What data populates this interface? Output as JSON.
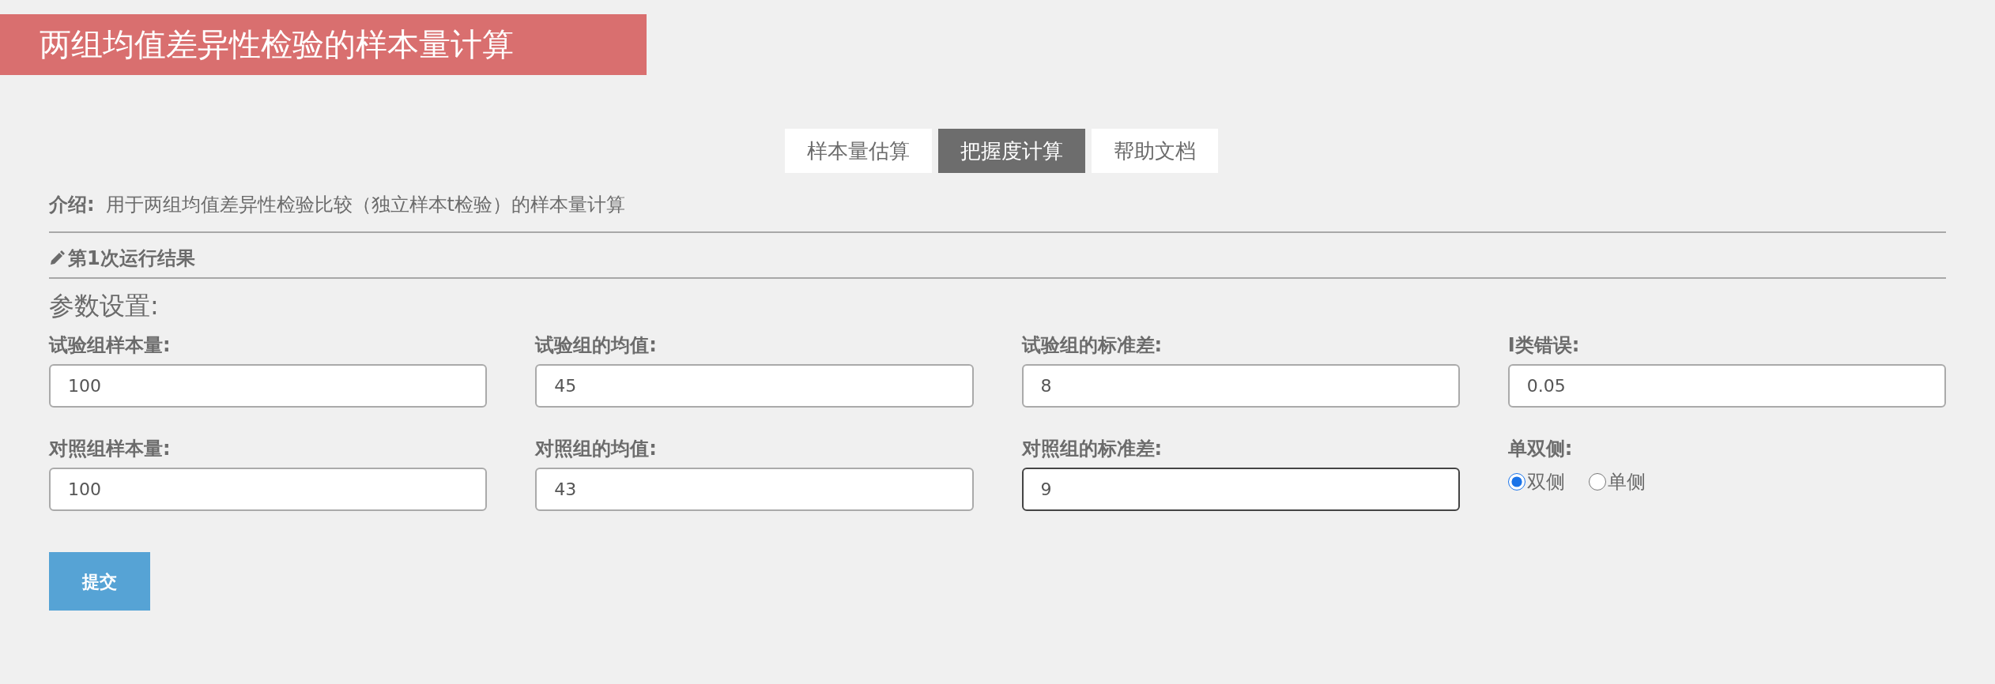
{
  "title": "两组均值差异性检验的样本量计算",
  "tabs": [
    {
      "label": "样本量估算",
      "selected": false
    },
    {
      "label": "把握度计算",
      "selected": true
    },
    {
      "label": "帮助文档",
      "selected": false
    }
  ],
  "intro": {
    "label": "介绍:",
    "text": "用于两组均值差异性检验比较（独立样本t检验）的样本量计算"
  },
  "run_header": "第1次运行结果",
  "section_title": "参数设置:",
  "fields": [
    {
      "kind": "input",
      "label": "试验组样本量:",
      "value": "100",
      "focused": false
    },
    {
      "kind": "input",
      "label": "试验组的均值:",
      "value": "45",
      "focused": false
    },
    {
      "kind": "input",
      "label": "试验组的标准差:",
      "value": "8",
      "focused": false
    },
    {
      "kind": "input",
      "label": "Ⅰ类错误:",
      "value": "0.05",
      "focused": false
    },
    {
      "kind": "input",
      "label": "对照组样本量:",
      "value": "100",
      "focused": false
    },
    {
      "kind": "input",
      "label": "对照组的均值:",
      "value": "43",
      "focused": false
    },
    {
      "kind": "input",
      "label": "对照组的标准差:",
      "value": "9",
      "focused": true
    },
    {
      "kind": "radio",
      "label": "单双侧:",
      "options": [
        {
          "label": "双侧",
          "selected": true
        },
        {
          "label": "单侧",
          "selected": false
        }
      ]
    }
  ],
  "submit": "提交"
}
